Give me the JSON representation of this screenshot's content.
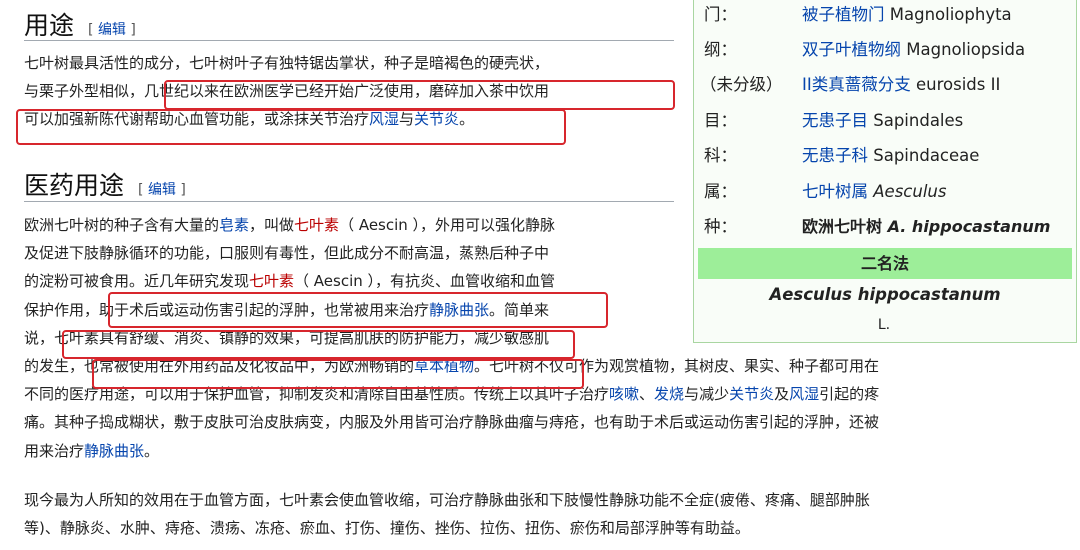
{
  "sections": {
    "uses": {
      "title": "用途",
      "edit": "编辑"
    },
    "medical": {
      "title": "医药用途",
      "edit": "编辑"
    }
  },
  "edit_brackets": {
    "open": "[",
    "close": "]"
  },
  "p1": {
    "l1": "七叶树最具活性的成分，七叶树叶子有独特锯齿掌状，种子是暗褐色的硬壳状，",
    "l2": "与栗子外型相似，几世纪以来在欧洲医学已经开始广泛使用，磨碎加入茶中饮用",
    "l3a": "可以加强新陈代谢帮助心血管功能，或涂抹关节治疗",
    "l3_link1": "风湿",
    "l3b": "与",
    "l3_link2": "关节炎",
    "l3c": "。"
  },
  "p2": {
    "l1a": "欧洲七叶树的种子含有大量的",
    "l1_link": "皂素",
    "l1b": "，叫做",
    "l1_red": "七叶素",
    "l1c": "（ Aescin ），外用可以强化静脉",
    "l2": "及促进下肢静脉循环的功能，口服则有毒性，但此成分不耐高温，蒸熟后种子中",
    "l3a": "的淀粉可被食用。近几年研究发现",
    "l3_red": "七叶素",
    "l3b": "（ Aescin ），有抗炎、血管收缩和血管",
    "l4a": "保护作用，助于术后或运动伤害引起的浮肿，也常被用来治疗",
    "l4_link": "静脉曲张",
    "l4b": "。简单来",
    "l5": "说，七叶素具有舒缓、消炎、镇静的效果，可提高肌肤的防护能力，减少敏感肌",
    "l6a": "的发生，也常被使用在外用药品及化妆品中，为欧洲畅销的",
    "l6_link": "草本植物",
    "l6b": "。七叶树不仅可作为观赏植物，其树皮、果实、种子都可用在",
    "l7a": "不同的医疗用途，可以用于保护血管，抑制发炎和清除自由基性质。传统上以其叶子治疗",
    "l7_link1": "咳嗽",
    "l7b": "、",
    "l7_link2": "发烧",
    "l7c": "与减少",
    "l7_link3": "关节炎",
    "l7d": "及",
    "l7_link4": "风湿",
    "l7e": "引起的疼",
    "l8": "痛。其种子捣成糊状，敷于皮肤可治皮肤病变，内服及外用皆可治疗静脉曲瘤与痔疮，也有助于术后或运动伤害引起的浮肿，还被",
    "l9a": "用来治疗",
    "l9_link": "静脉曲张",
    "l9b": "。"
  },
  "p3": {
    "l1": "现今最为人所知的效用在于血管方面，七叶素会使血管收缩，可治疗静脉曲张和下肢慢性静脉功能不全症(疲倦、疼痛、腿部肿胀",
    "l2": "等)、静脉炎、水肿、痔疮、溃疡、冻疮、瘀血、打伤、撞伤、挫伤、拉伤、扭伤、瘀伤和局部浮肿等有助益。"
  },
  "taxonomy": [
    {
      "rank": "门：",
      "link": "被子植物门",
      "latin": "Magnoliophyta"
    },
    {
      "rank": "纲：",
      "link": "双子叶植物纲",
      "latin": "Magnoliopsida"
    },
    {
      "rank": "（未分级）",
      "link": "II类真蔷薇分支",
      "latin": "eurosids II"
    },
    {
      "rank": "目：",
      "link": "无患子目",
      "latin": "Sapindales"
    },
    {
      "rank": "科：",
      "link": "无患子科",
      "latin": "Sapindaceae"
    },
    {
      "rank": "属：",
      "link": "七叶树属",
      "latin": "Aesculus"
    },
    {
      "rank": "种：",
      "name": "欧洲七叶树",
      "latin": "A. hippocastanum"
    }
  ],
  "binomial": {
    "header": "二名法",
    "name": "Aesculus hippocastanum",
    "author": "L."
  },
  "colors": {
    "link": "#0645ad",
    "red_link": "#ba0000",
    "highlight_box": "#d7262d",
    "binomial_bg": "#9dee99",
    "infobox_border": "#a9d6a1"
  }
}
